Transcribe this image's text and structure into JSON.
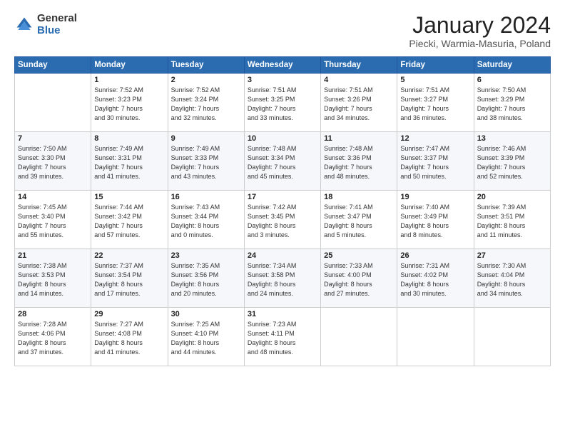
{
  "logo": {
    "general": "General",
    "blue": "Blue"
  },
  "header": {
    "title": "January 2024",
    "subtitle": "Piecki, Warmia-Masuria, Poland"
  },
  "days_of_week": [
    "Sunday",
    "Monday",
    "Tuesday",
    "Wednesday",
    "Thursday",
    "Friday",
    "Saturday"
  ],
  "weeks": [
    [
      {
        "day": "",
        "content": ""
      },
      {
        "day": "1",
        "content": "Sunrise: 7:52 AM\nSunset: 3:23 PM\nDaylight: 7 hours\nand 30 minutes."
      },
      {
        "day": "2",
        "content": "Sunrise: 7:52 AM\nSunset: 3:24 PM\nDaylight: 7 hours\nand 32 minutes."
      },
      {
        "day": "3",
        "content": "Sunrise: 7:51 AM\nSunset: 3:25 PM\nDaylight: 7 hours\nand 33 minutes."
      },
      {
        "day": "4",
        "content": "Sunrise: 7:51 AM\nSunset: 3:26 PM\nDaylight: 7 hours\nand 34 minutes."
      },
      {
        "day": "5",
        "content": "Sunrise: 7:51 AM\nSunset: 3:27 PM\nDaylight: 7 hours\nand 36 minutes."
      },
      {
        "day": "6",
        "content": "Sunrise: 7:50 AM\nSunset: 3:29 PM\nDaylight: 7 hours\nand 38 minutes."
      }
    ],
    [
      {
        "day": "7",
        "content": "Sunrise: 7:50 AM\nSunset: 3:30 PM\nDaylight: 7 hours\nand 39 minutes."
      },
      {
        "day": "8",
        "content": "Sunrise: 7:49 AM\nSunset: 3:31 PM\nDaylight: 7 hours\nand 41 minutes."
      },
      {
        "day": "9",
        "content": "Sunrise: 7:49 AM\nSunset: 3:33 PM\nDaylight: 7 hours\nand 43 minutes."
      },
      {
        "day": "10",
        "content": "Sunrise: 7:48 AM\nSunset: 3:34 PM\nDaylight: 7 hours\nand 45 minutes."
      },
      {
        "day": "11",
        "content": "Sunrise: 7:48 AM\nSunset: 3:36 PM\nDaylight: 7 hours\nand 48 minutes."
      },
      {
        "day": "12",
        "content": "Sunrise: 7:47 AM\nSunset: 3:37 PM\nDaylight: 7 hours\nand 50 minutes."
      },
      {
        "day": "13",
        "content": "Sunrise: 7:46 AM\nSunset: 3:39 PM\nDaylight: 7 hours\nand 52 minutes."
      }
    ],
    [
      {
        "day": "14",
        "content": "Sunrise: 7:45 AM\nSunset: 3:40 PM\nDaylight: 7 hours\nand 55 minutes."
      },
      {
        "day": "15",
        "content": "Sunrise: 7:44 AM\nSunset: 3:42 PM\nDaylight: 7 hours\nand 57 minutes."
      },
      {
        "day": "16",
        "content": "Sunrise: 7:43 AM\nSunset: 3:44 PM\nDaylight: 8 hours\nand 0 minutes."
      },
      {
        "day": "17",
        "content": "Sunrise: 7:42 AM\nSunset: 3:45 PM\nDaylight: 8 hours\nand 3 minutes."
      },
      {
        "day": "18",
        "content": "Sunrise: 7:41 AM\nSunset: 3:47 PM\nDaylight: 8 hours\nand 5 minutes."
      },
      {
        "day": "19",
        "content": "Sunrise: 7:40 AM\nSunset: 3:49 PM\nDaylight: 8 hours\nand 8 minutes."
      },
      {
        "day": "20",
        "content": "Sunrise: 7:39 AM\nSunset: 3:51 PM\nDaylight: 8 hours\nand 11 minutes."
      }
    ],
    [
      {
        "day": "21",
        "content": "Sunrise: 7:38 AM\nSunset: 3:53 PM\nDaylight: 8 hours\nand 14 minutes."
      },
      {
        "day": "22",
        "content": "Sunrise: 7:37 AM\nSunset: 3:54 PM\nDaylight: 8 hours\nand 17 minutes."
      },
      {
        "day": "23",
        "content": "Sunrise: 7:35 AM\nSunset: 3:56 PM\nDaylight: 8 hours\nand 20 minutes."
      },
      {
        "day": "24",
        "content": "Sunrise: 7:34 AM\nSunset: 3:58 PM\nDaylight: 8 hours\nand 24 minutes."
      },
      {
        "day": "25",
        "content": "Sunrise: 7:33 AM\nSunset: 4:00 PM\nDaylight: 8 hours\nand 27 minutes."
      },
      {
        "day": "26",
        "content": "Sunrise: 7:31 AM\nSunset: 4:02 PM\nDaylight: 8 hours\nand 30 minutes."
      },
      {
        "day": "27",
        "content": "Sunrise: 7:30 AM\nSunset: 4:04 PM\nDaylight: 8 hours\nand 34 minutes."
      }
    ],
    [
      {
        "day": "28",
        "content": "Sunrise: 7:28 AM\nSunset: 4:06 PM\nDaylight: 8 hours\nand 37 minutes."
      },
      {
        "day": "29",
        "content": "Sunrise: 7:27 AM\nSunset: 4:08 PM\nDaylight: 8 hours\nand 41 minutes."
      },
      {
        "day": "30",
        "content": "Sunrise: 7:25 AM\nSunset: 4:10 PM\nDaylight: 8 hours\nand 44 minutes."
      },
      {
        "day": "31",
        "content": "Sunrise: 7:23 AM\nSunset: 4:11 PM\nDaylight: 8 hours\nand 48 minutes."
      },
      {
        "day": "",
        "content": ""
      },
      {
        "day": "",
        "content": ""
      },
      {
        "day": "",
        "content": ""
      }
    ]
  ]
}
